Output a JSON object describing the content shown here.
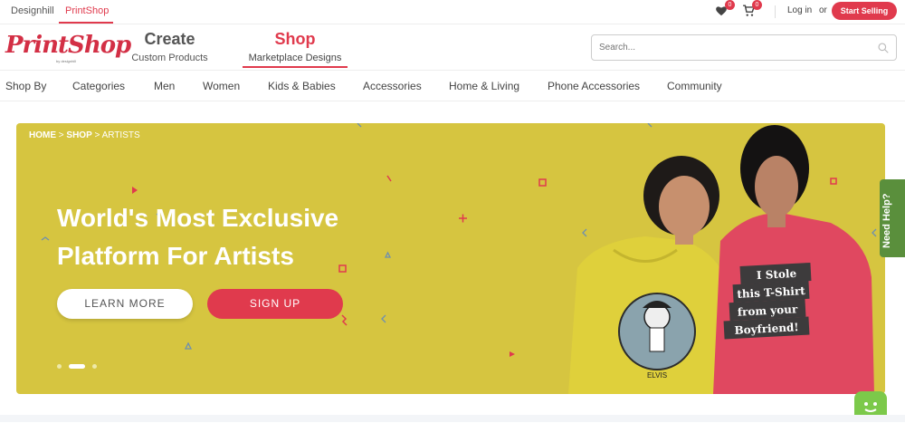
{
  "topbar": {
    "tabs": [
      "Designhill",
      "PrintShop"
    ],
    "wishlist_count": "0",
    "cart_count": "0",
    "login": "Log in",
    "or": "or",
    "start_selling": "Start Selling"
  },
  "header": {
    "logo": "PrintShop",
    "logo_sub": "by designhill",
    "create_title": "Create",
    "create_sub": "Custom Products",
    "shop_title": "Shop",
    "shop_sub": "Marketplace Designs",
    "search_placeholder": "Search..."
  },
  "nav": {
    "items": [
      "Shop By",
      "Categories",
      "Men",
      "Women",
      "Kids & Babies",
      "Accessories",
      "Home & Living",
      "Phone Accessories",
      "Community"
    ]
  },
  "hero": {
    "breadcrumb_home": "HOME",
    "breadcrumb_sep": ">",
    "breadcrumb_shop": "SHOP",
    "breadcrumb_current": "ARTISTS",
    "headline_line1": "World's Most Exclusive",
    "headline_line2": "Platform For Artists",
    "learn_more": "LEARN MORE",
    "sign_up": "SIGN UP",
    "shirt_text": [
      "I Stole",
      "this T-Shirt",
      "from your",
      "Boyfriend!"
    ],
    "print_caption": "ELVIS",
    "slides": 3,
    "active_slide": 2
  },
  "help": {
    "label": "Need Help?"
  },
  "colors": {
    "accent": "#e03a4d",
    "hero_bg": "#d6c540",
    "help_bg": "#5a8f3c"
  }
}
